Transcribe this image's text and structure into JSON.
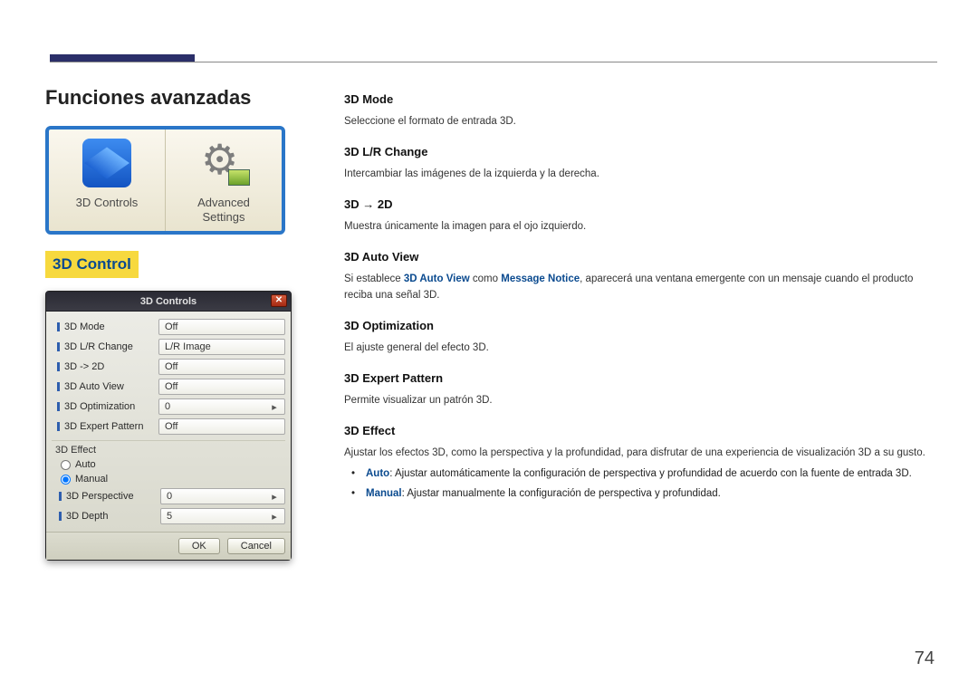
{
  "header": {
    "chapter_title": "Funciones avanzadas"
  },
  "icon_tile": {
    "left_label": "3D Controls",
    "right_label_line1": "Advanced",
    "right_label_line2": "Settings"
  },
  "section_title": "3D Control",
  "dialog": {
    "title": "3D Controls",
    "rows": [
      {
        "label": "3D Mode",
        "value": "Off"
      },
      {
        "label": "3D L/R Change",
        "value": "L/R Image"
      },
      {
        "label": "3D -> 2D",
        "value": "Off"
      },
      {
        "label": "3D Auto View",
        "value": "Off"
      },
      {
        "label": "3D Optimization",
        "value": "0",
        "spinner": true
      },
      {
        "label": "3D Expert Pattern",
        "value": "Off"
      }
    ],
    "effect_group_label": "3D Effect",
    "radios": {
      "auto": "Auto",
      "manual": "Manual",
      "selected": "manual"
    },
    "sub_rows": [
      {
        "label": "3D Perspective",
        "value": "0",
        "spinner": true
      },
      {
        "label": "3D Depth",
        "value": "5",
        "spinner": true
      }
    ],
    "buttons": {
      "ok": "OK",
      "cancel": "Cancel"
    }
  },
  "content": {
    "s1": {
      "title": "3D Mode",
      "body": "Seleccione el formato de entrada 3D."
    },
    "s2": {
      "title": "3D L/R Change",
      "body": "Intercambiar las imágenes de la izquierda y la derecha."
    },
    "s3": {
      "title": "3D → 2D",
      "body": "Muestra únicamente la imagen para el ojo izquierdo."
    },
    "s4": {
      "title": "3D Auto View",
      "pre": "Si establece ",
      "link1": "3D Auto View",
      "mid": " como ",
      "link2": "Message Notice",
      "post": ", aparecerá una ventana emergente con un mensaje cuando el producto reciba una señal 3D."
    },
    "s5": {
      "title": "3D Optimization",
      "body": "El ajuste general del efecto 3D."
    },
    "s6": {
      "title": "3D Expert Pattern",
      "body": "Permite visualizar un patrón 3D."
    },
    "s7": {
      "title": "3D Effect",
      "body": "Ajustar los efectos 3D, como la perspectiva y la profundidad, para disfrutar de una experiencia de visualización 3D a su gusto.",
      "bullets": [
        {
          "strong": "Auto",
          "rest": ": Ajustar automáticamente la configuración de perspectiva y profundidad de acuerdo con la fuente de entrada 3D."
        },
        {
          "strong": "Manual",
          "rest": ": Ajustar manualmente la configuración de perspectiva y profundidad."
        }
      ]
    }
  },
  "page_number": "74"
}
